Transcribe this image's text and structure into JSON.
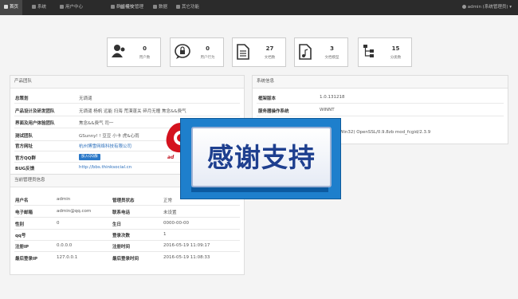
{
  "nav": {
    "items": [
      {
        "label": "首页",
        "active": true
      },
      {
        "label": "系统"
      },
      {
        "label": "用户中心"
      },
      {
        "label": "群组模块"
      },
      {
        "label": "社交管理"
      },
      {
        "label": "数据"
      },
      {
        "label": "其它功能"
      }
    ],
    "user": "admin (系统管理员) ▾"
  },
  "stats": [
    {
      "value": "0",
      "label": "用户数",
      "icon": "user-icon"
    },
    {
      "value": "0",
      "label": "用户行为",
      "icon": "lock-chat-icon"
    },
    {
      "value": "27",
      "label": "文档数",
      "icon": "document-icon"
    },
    {
      "value": "3",
      "label": "文档模型",
      "icon": "music-file-icon"
    },
    {
      "value": "15",
      "label": "分类数",
      "icon": "tree-icon"
    }
  ],
  "team": {
    "title": "产品团队",
    "rows": [
      {
        "k": "总策划",
        "v": "无谪谴"
      },
      {
        "k": "产品设计及研发团队",
        "v": "无谪谴 杨帆 远能 扫海 荒漠蓬关 碎月无瞳 焦念&&费气"
      },
      {
        "k": "界面及用户体验团队",
        "v": "焦念&&费气 司一"
      },
      {
        "k": "测试团队",
        "v": "GSunny! ! 豆豆 小卡 虎&心雨"
      },
      {
        "k": "官方网址",
        "v": "杭州博雪网络科技有限公司"
      },
      {
        "k": "官方QQ群",
        "v": "加入QQ群"
      },
      {
        "k": "BUG反馈",
        "v": "http://bbs.thinksocial.cn"
      }
    ]
  },
  "system": {
    "title": "系统信息",
    "rows": [
      {
        "k": "框架版本",
        "v": "1.0.131218"
      },
      {
        "k": "服务器操作系统",
        "v": "WINNT"
      },
      {
        "k": "",
        "v": "Win32) OpenSSL/0.9.8zb mod_fcgid/2.3.9"
      }
    ]
  },
  "admin": {
    "title": "当前管理员信息",
    "rows": [
      {
        "k1": "用户名",
        "v1": "admin",
        "k2": "管理员状态",
        "v2": "正常"
      },
      {
        "k1": "电子邮箱",
        "v1": "admin@qq.com",
        "k2": "联系电话",
        "v2": "未设置"
      },
      {
        "k1": "性别",
        "v1": "0",
        "k2": "生日",
        "v2": "0000-00-00"
      },
      {
        "k1": "qq号",
        "v1": "",
        "k2": "登录次数",
        "v2": "1"
      },
      {
        "k1": "注册IP",
        "v1": "0.0.0.0",
        "k2": "注册时间",
        "v2": "2016-05-19 11:09:17"
      },
      {
        "k1": "最后登录IP",
        "v1": "127.0.0.1",
        "k2": "最后登录时间",
        "v2": "2016-05-19 11:08:33"
      }
    ]
  },
  "overlay": {
    "thanks": "感谢支持",
    "logo_text": "ad"
  }
}
